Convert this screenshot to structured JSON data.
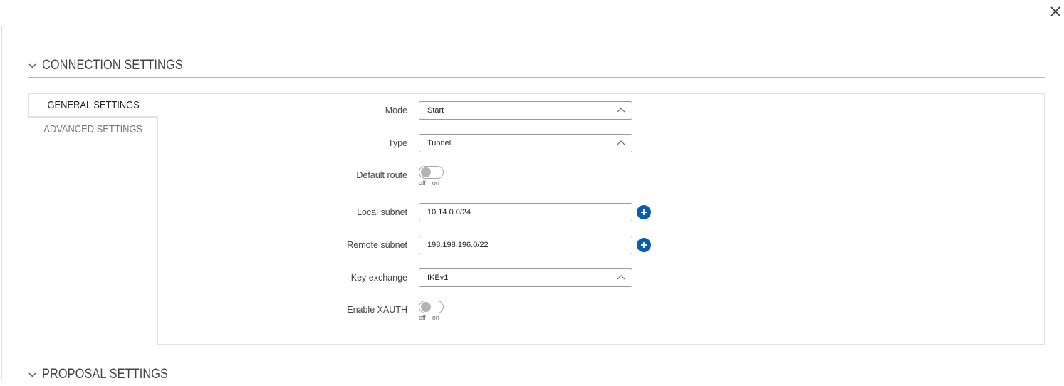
{
  "sections": {
    "connection": {
      "title": "CONNECTION SETTINGS"
    },
    "proposal": {
      "title": "PROPOSAL SETTINGS"
    }
  },
  "tabs": [
    {
      "label": "GENERAL SETTINGS",
      "active": true
    },
    {
      "label": "ADVANCED SETTINGS",
      "active": false
    }
  ],
  "fields": {
    "mode": {
      "label": "Mode",
      "value": "Start"
    },
    "type": {
      "label": "Type",
      "value": "Tunnel"
    },
    "default_route": {
      "label": "Default route",
      "off": "off",
      "on": "on",
      "state": "off"
    },
    "local_subnet": {
      "label": "Local subnet",
      "value": "10.14.0.0/24"
    },
    "remote_subnet": {
      "label": "Remote subnet",
      "value": "198.198.196.0/22"
    },
    "key_exchange": {
      "label": "Key exchange",
      "value": "IKEv1"
    },
    "enable_xauth": {
      "label": "Enable XAUTH",
      "off": "off",
      "on": "on",
      "state": "off"
    }
  },
  "icons": {
    "close": "close-icon",
    "chevron": "chevron-down-icon",
    "caret": "chevron-up-icon",
    "add": "plus-icon"
  },
  "colors": {
    "accent": "#0b5cab",
    "toggle_knob": "#b3b3b3"
  }
}
